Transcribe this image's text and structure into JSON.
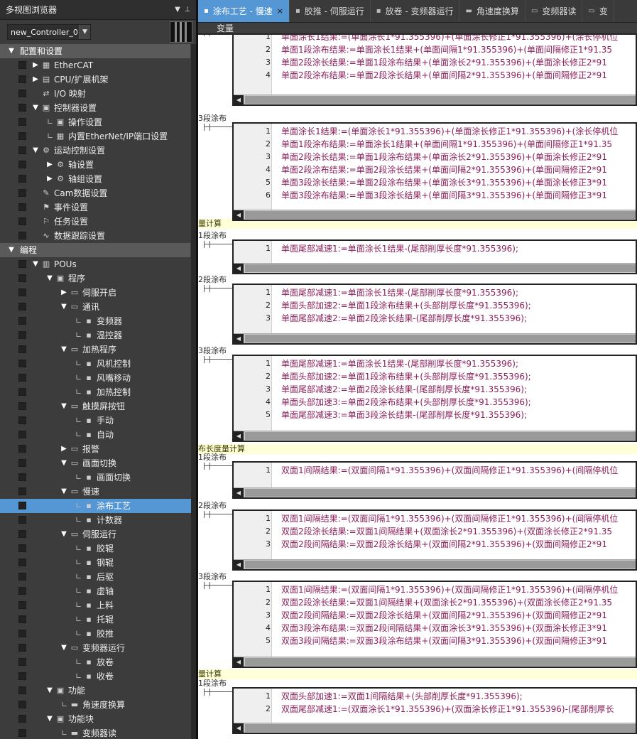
{
  "left_panel": {
    "title": "多视图浏览器",
    "pin_icon": "pin-icon",
    "dropdown_icon": "chevron-down-icon",
    "controller": "new_Controller_0"
  },
  "tree": [
    {
      "level": 0,
      "toggle": "open",
      "label": "配置和设置",
      "type": "section",
      "box": false
    },
    {
      "level": 1,
      "toggle": "closed",
      "icon": "network-icon",
      "label": "EtherCAT",
      "box": true
    },
    {
      "level": 1,
      "toggle": "closed",
      "icon": "cpu-icon",
      "label": "CPU/扩展机架",
      "box": true
    },
    {
      "level": 1,
      "toggle": "none",
      "icon": "io-icon",
      "label": "I/O 映射",
      "box": true
    },
    {
      "level": 1,
      "toggle": "open",
      "icon": "settings-icon",
      "label": "控制器设置",
      "box": true
    },
    {
      "level": 2,
      "toggle": "leaf",
      "icon": "settings-icon",
      "label": "操作设置",
      "box": true
    },
    {
      "level": 2,
      "toggle": "leaf",
      "icon": "network-icon",
      "label": "内置EtherNet/IP端口设置",
      "box": true
    },
    {
      "level": 1,
      "toggle": "open",
      "icon": "gear-icon",
      "label": "运动控制设置",
      "box": true
    },
    {
      "level": 2,
      "toggle": "closed",
      "icon": "gear-icon",
      "label": "轴设置",
      "box": true
    },
    {
      "level": 2,
      "toggle": "closed",
      "icon": "gear-icon",
      "label": "轴组设置",
      "box": true
    },
    {
      "level": 1,
      "toggle": "none",
      "icon": "cam-icon",
      "label": "Cam数据设置",
      "box": true
    },
    {
      "level": 1,
      "toggle": "none",
      "icon": "flag-icon",
      "label": "事件设置",
      "box": true
    },
    {
      "level": 1,
      "toggle": "none",
      "icon": "task-icon",
      "label": "任务设置",
      "box": true
    },
    {
      "level": 1,
      "toggle": "none",
      "icon": "trace-icon",
      "label": "数据跟踪设置",
      "box": true
    },
    {
      "level": 0,
      "toggle": "open",
      "label": "编程",
      "type": "section",
      "box": false
    },
    {
      "level": 1,
      "toggle": "open",
      "icon": "document-icon",
      "label": "POUs",
      "box": true
    },
    {
      "level": 2,
      "toggle": "open",
      "icon": "program-icon",
      "label": "程序",
      "box": true
    },
    {
      "level": 3,
      "toggle": "closed",
      "icon": "st-icon",
      "label": "伺服开启",
      "box": true
    },
    {
      "level": 3,
      "toggle": "open",
      "icon": "st-icon",
      "label": "通讯",
      "box": true
    },
    {
      "level": 4,
      "toggle": "leaf",
      "icon": "section-icon",
      "label": "变频器",
      "box": true
    },
    {
      "level": 4,
      "toggle": "leaf",
      "icon": "section-icon",
      "label": "温控器",
      "box": true
    },
    {
      "level": 3,
      "toggle": "open",
      "icon": "st-icon",
      "label": "加热程序",
      "box": true
    },
    {
      "level": 4,
      "toggle": "leaf",
      "icon": "section-icon",
      "label": "风机控制",
      "box": true
    },
    {
      "level": 4,
      "toggle": "leaf",
      "icon": "section-icon",
      "label": "风嘴移动",
      "box": true
    },
    {
      "level": 4,
      "toggle": "leaf",
      "icon": "section-icon",
      "label": "加热控制",
      "box": true
    },
    {
      "level": 3,
      "toggle": "open",
      "icon": "st-icon",
      "label": "触摸屏按钮",
      "box": true
    },
    {
      "level": 4,
      "toggle": "leaf",
      "icon": "section-icon",
      "label": "手动",
      "box": true
    },
    {
      "level": 4,
      "toggle": "leaf",
      "icon": "section-icon",
      "label": "自动",
      "box": true
    },
    {
      "level": 3,
      "toggle": "closed",
      "icon": "st-icon",
      "label": "报警",
      "box": true
    },
    {
      "level": 3,
      "toggle": "open",
      "icon": "st-icon",
      "label": "画面切换",
      "box": true
    },
    {
      "level": 4,
      "toggle": "leaf",
      "icon": "section-icon",
      "label": "画面切换",
      "box": true
    },
    {
      "level": 3,
      "toggle": "open",
      "icon": "st-icon",
      "label": "慢速",
      "box": true
    },
    {
      "level": 4,
      "toggle": "leaf",
      "icon": "section-icon",
      "label": "涂布工艺",
      "box": true,
      "selected": true
    },
    {
      "level": 4,
      "toggle": "leaf",
      "icon": "section-icon",
      "label": "计数器",
      "box": true
    },
    {
      "level": 3,
      "toggle": "open",
      "icon": "st-icon",
      "label": "伺服运行",
      "box": true
    },
    {
      "level": 4,
      "toggle": "leaf",
      "icon": "section-icon",
      "label": "胶辊",
      "box": true
    },
    {
      "level": 4,
      "toggle": "leaf",
      "icon": "section-icon",
      "label": "钢辊",
      "box": true
    },
    {
      "level": 4,
      "toggle": "leaf",
      "icon": "section-icon",
      "label": "后驱",
      "box": true
    },
    {
      "level": 4,
      "toggle": "leaf",
      "icon": "section-icon",
      "label": "虚轴",
      "box": true
    },
    {
      "level": 4,
      "toggle": "leaf",
      "icon": "section-icon",
      "label": "上料",
      "box": true
    },
    {
      "level": 4,
      "toggle": "leaf",
      "icon": "section-icon",
      "label": "托辊",
      "box": true
    },
    {
      "level": 4,
      "toggle": "leaf",
      "icon": "section-icon",
      "label": "胶推",
      "box": true
    },
    {
      "level": 3,
      "toggle": "open",
      "icon": "st-icon",
      "label": "变频器运行",
      "box": true
    },
    {
      "level": 4,
      "toggle": "leaf",
      "icon": "section-icon",
      "label": "放卷",
      "box": true
    },
    {
      "level": 4,
      "toggle": "leaf",
      "icon": "section-icon",
      "label": "收卷",
      "box": true
    },
    {
      "level": 2,
      "toggle": "open",
      "icon": "program-icon",
      "label": "功能",
      "box": true
    },
    {
      "level": 3,
      "toggle": "leaf",
      "icon": "function-icon",
      "label": "角速度换算",
      "box": true
    },
    {
      "level": 2,
      "toggle": "open",
      "icon": "program-icon",
      "label": "功能块",
      "box": true
    },
    {
      "level": 3,
      "toggle": "leaf",
      "icon": "function-icon",
      "label": "变频器读",
      "box": true
    }
  ],
  "tabs": [
    {
      "label": "涂布工艺 - 慢速",
      "active": true,
      "icon": "section-icon",
      "close": "×"
    },
    {
      "label": "胶推 - 伺服运行",
      "active": false,
      "icon": "section-icon"
    },
    {
      "label": "放卷 - 变频器运行",
      "active": false,
      "icon": "section-icon"
    },
    {
      "label": "角速度换算",
      "active": false,
      "icon": "function-icon"
    },
    {
      "label": "变频器读",
      "active": false,
      "icon": "fb-icon"
    },
    {
      "label": "变",
      "active": false,
      "icon": "fb-icon"
    }
  ],
  "var_bar": "变量",
  "editor": {
    "headings": [
      {
        "text": "量计算"
      },
      {
        "text": "布长度量计算"
      },
      {
        "text": "量计算"
      }
    ],
    "blocks": [
      {
        "label": "",
        "lines": [
          "单面涂长1结果:=(单面涂长1*91.355396)+(单面涂长修正1*91.355396)+(涂长停机位",
          "单面1段涂布结果:=单面涂长1结果+(单面间隔1*91.355396)+(单面间隔修正1*91.35",
          "单面2段涂长结果:=单面1段涂布结果+(单面涂长2*91.355396)+(单面涂长修正2*91",
          "单面2段涂布结果:=单面2段涂长结果+(单面间隔2*91.355396)+(单面间隔修正2*91"
        ]
      },
      {
        "label": "3段涂布",
        "lines": [
          "单面涂长1结果:=(单面涂长1*91.355396)+(单面涂长修正1*91.355396)+(涂长停机位",
          "单面1段涂布结果:=单面涂长1结果+(单面间隔1*91.355396)+(单面间隔修正1*91.35",
          "单面2段涂长结果:=单面1段涂布结果+(单面涂长2*91.355396)+(单面涂长修正2*91",
          "单面2段涂布结果:=单面2段涂长结果+(单面间隔2*91.355396)+(单面间隔修正2*91",
          "单面3段涂长结果:=单面2段涂布结果+(单面涂长3*91.355396)+(单面涂长修正3*91",
          "单面3段涂布结果:=单面3段涂长结果+(单面间隔3*91.355396)+(单面间隔修正3*91"
        ]
      },
      {
        "label": "1段涂布",
        "lines": [
          "单面尾部减速1:=单面涂长1结果-(尾部削厚长度*91.355396);"
        ]
      },
      {
        "label": "2段涂布",
        "lines": [
          "单面尾部减速1:=单面涂长1结果-(尾部削厚长度*91.355396);",
          "单面头部加速2:=单面1段涂布结果+(头部削厚长度*91.355396);",
          "单面尾部减速2:=单面2段涂长结果-(尾部削厚长度*91.355396);"
        ]
      },
      {
        "label": "3段涂布",
        "lines": [
          "单面尾部减速1:=单面涂长1结果-(尾部削厚长度*91.355396);",
          "单面头部加速2:=单面1段涂布结果+(头部削厚长度*91.355396);",
          "单面尾部减速2:=单面2段涂长结果-(尾部削厚长度*91.355396);",
          "单面头部加速3:=单面2段涂布结果+(头部削厚长度*91.355396);",
          "单面尾部减速3:=单面3段涂长结果-(尾部削厚长度*91.355396);"
        ]
      },
      {
        "label": "1段涂布",
        "lines": [
          "双面1间隔结果:=(双面间隔1*91.355396)+(双面间隔修正1*91.355396)+(间隔停机位"
        ]
      },
      {
        "label": "2段涂布",
        "lines": [
          "双面1间隔结果:=(双面间隔1*91.355396)+(双面间隔修正1*91.355396)+(间隔停机位",
          "双面2段涂长结果:=双面1间隔结果+(双面涂长2*91.355396)+(双面涂长修正2*91.35",
          "双面2段间隔结果:=双面2段涂长结果+(双面间隔2*91.355396)+(双面间隔修正2*91"
        ]
      },
      {
        "label": "3段涂布",
        "lines": [
          "双面1间隔结果:=(双面间隔1*91.355396)+(双面间隔修正1*91.355396)+(间隔停机位",
          "双面2段涂长结果:=双面1间隔结果+(双面涂长2*91.355396)+(双面涂长修正2*91.35",
          "双面2段间隔结果:=双面2段涂长结果+(双面间隔2*91.355396)+(双面间隔修正2*91",
          "双面3段涂布结果:=双面2段间隔结果+(双面涂长3*91.355396)+(双面涂长修正3*91",
          "双面3段间隔结果:=双面3段涂布结果+(双面间隔3*91.355396)+(双面间隔修正3*91"
        ]
      },
      {
        "label": "1段涂布",
        "lines": [
          "双面头部加速1:=双面1间隔结果+(头部削厚长度*91.355396);",
          "双面尾部减速1:=(双面涂长1*91.355396)+(双面涂长修正1*91.355396)-(尾部削厚长"
        ]
      }
    ]
  }
}
